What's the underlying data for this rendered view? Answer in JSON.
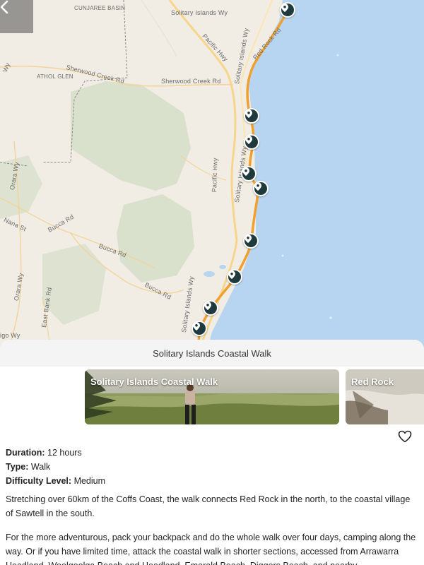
{
  "map": {
    "labels": {
      "cunjaree": "CUNJAREE BASIN",
      "solitary_wy_top": "Solitary Islands Wy",
      "pacific_hwy_top": "Pacific Hwy",
      "red_rock_rd": "Red Rock Rd",
      "solitary_wy_vert": "Solitary Islands Wy",
      "athol_glen": "ATHOL GLEN",
      "sherwood_creek_rd_left": "Sherwood Creek Rd",
      "sherwood_creek_rd_right": "Sherwood Creek Rd",
      "orara_wy_top": "Orara Wy",
      "pacific_hwy_mid": "Pacific Hwy",
      "solitary_wy_mid": "Solitary Islands Wy",
      "nana_st": "Nana St",
      "bucca_rd_1": "Bucca Rd",
      "bucca_rd_2": "Bucca Rd",
      "bucca_rd_3": "Bucca Rd",
      "orara_wy_bottom": "Orara Wy",
      "east_bank_rd": "East Bank Rd",
      "solitary_wy_bottom": "Solitary Islands Wy",
      "igo_wy": "igo Wy",
      "wy_left": "Wy"
    },
    "colors": {
      "water": "#b5d4ef",
      "land": "#f1ede4",
      "forest": "#d8dfca",
      "route": "#f0a030",
      "pin": "#1f3a3d"
    },
    "pin_count": 9
  },
  "back_button": {
    "icon": "chevron-left-icon"
  },
  "sheet": {
    "header_title": "Solitary Islands Coastal Walk",
    "cards": [
      {
        "title": "Solitary Islands Coastal Walk"
      },
      {
        "title": "Red Rock"
      }
    ],
    "favorite_icon": "heart-outline-icon",
    "duration_label": "Duration:",
    "duration_value": "12 hours",
    "type_label": "Type:",
    "type_value": "Walk",
    "difficulty_label": "Difficulty Level:",
    "difficulty_value": "Medium",
    "paragraph_1": "Stretching over 60km of the Coffs Coast, the walk connects Red Rock in the north, to the coastal village of Sawtell in the south.",
    "paragraph_2": "For the more adventurous, pack your backpack and do the whole walk over four days, camping along the way. Or if you have limited time, attack the coastal walk in shorter sections, accessed from Arrawarra Headland, Woolgoolga Beach and Headland, Emerald Beach, Diggers Beach, and nearby"
  }
}
